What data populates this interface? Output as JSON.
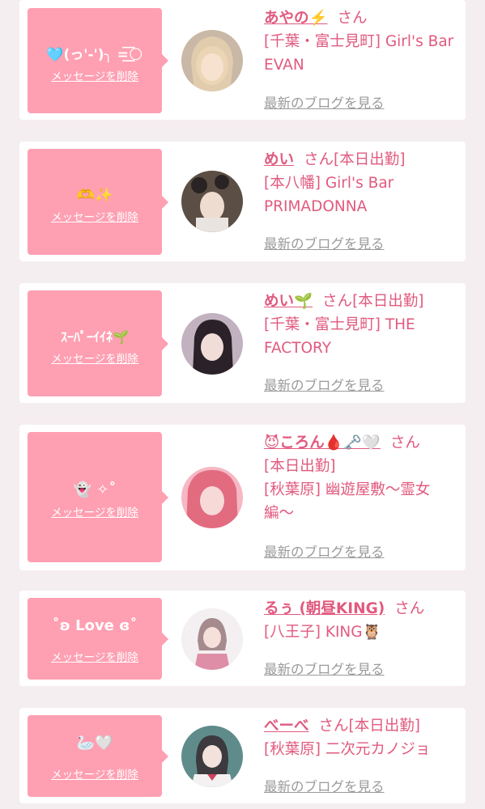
{
  "cards": [
    {
      "message": "🩵(っ'-')╮ =͟͟͞͞🌕",
      "delete_label": "メッセージを削除",
      "name": "あやの⚡️",
      "san": "さん",
      "status": "",
      "shop": "[千葉・富士見町] Girl's Bar EVAN",
      "blog_label": "最新のブログを見る",
      "avatar_colors": [
        "#c7b6a2",
        "#f0d7b8"
      ]
    },
    {
      "message": "🫶✨",
      "delete_label": "メッセージを削除",
      "name": "めい",
      "san": "さん",
      "status": "[本日出勤]",
      "shop": "[本八幡] Girl's Bar PRIMADONNA",
      "blog_label": "最新のブログを見る",
      "avatar_colors": [
        "#4a3f3a",
        "#e8d6cc"
      ]
    },
    {
      "message": "ｽｰﾊﾟｰｲｲﾈ🌱",
      "delete_label": "メッセージを削除",
      "name": "めい🌱",
      "san": "さん",
      "status": "[本日出勤]",
      "shop": "[千葉・富士見町] THE FACTORY",
      "blog_label": "最新のブログを見る",
      "avatar_colors": [
        "#b9a6b6",
        "#2e2530"
      ]
    },
    {
      "message": "👻 ✧˚",
      "delete_label": "メッセージを削除",
      "name": "😈ころん🩸🗝️🤍",
      "san": "さん",
      "status": "[本日出勤]",
      "shop": "[秋葉原] 幽遊屋敷〜霊女編〜",
      "blog_label": "最新のブログを見る",
      "avatar_colors": [
        "#e07a8a",
        "#f4c4cf"
      ]
    },
    {
      "message": "˚ʚ Love ɞ˚",
      "delete_label": "メッセージを削除",
      "name": "るぅ (朝昼KING)",
      "san": "さん",
      "status": "",
      "shop": "[八王子] KING🦉",
      "blog_label": "最新のブログを見る",
      "avatar_colors": [
        "#f3eef0",
        "#d98aa4"
      ]
    },
    {
      "message": "🦢🤍",
      "delete_label": "メッセージを削除",
      "name": "べーべ",
      "san": "さん",
      "status": "[本日出勤]",
      "shop": "[秋葉原] 二次元カノジョ",
      "blog_label": "最新のブログを見る",
      "avatar_colors": [
        "#5a8a8a",
        "#f2e8e6"
      ]
    }
  ]
}
